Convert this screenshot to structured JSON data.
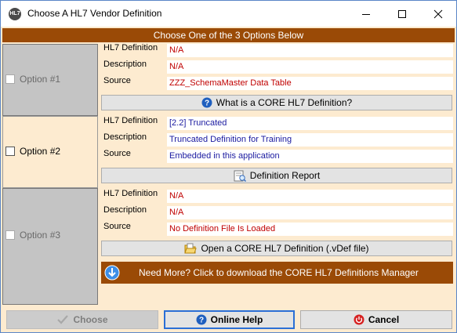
{
  "window": {
    "title": "Choose A HL7 Vendor Definition",
    "app_icon_text": "HL7"
  },
  "banner": {
    "text": "Choose One of the 3 Options Below"
  },
  "options": [
    {
      "label": "Option #1",
      "checked": false,
      "enabled": false,
      "fields": [
        {
          "label": "HL7 Definition",
          "value": "N/A",
          "color": "#c00000"
        },
        {
          "label": "Description",
          "value": "N/A",
          "color": "#c00000"
        },
        {
          "label": "Source",
          "value": "ZZZ_SchemaMaster Data Table",
          "color": "#c00000"
        }
      ],
      "button": {
        "label": "What is a CORE HL7 Definition?",
        "icon": "help-icon"
      }
    },
    {
      "label": "Option #2",
      "checked": false,
      "enabled": true,
      "fields": [
        {
          "label": "HL7 Definition",
          "value": "[2.2] Truncated",
          "color": "#1a1aa0"
        },
        {
          "label": "Description",
          "value": "Truncated Definition for Training",
          "color": "#1a1aa0"
        },
        {
          "label": "Source",
          "value": "Embedded in this application",
          "color": "#1a1aa0"
        }
      ],
      "button": {
        "label": "Definition Report",
        "icon": "report-icon"
      }
    },
    {
      "label": "Option #3",
      "checked": false,
      "enabled": false,
      "fields": [
        {
          "label": "HL7 Definition",
          "value": "N/A",
          "color": "#c00000"
        },
        {
          "label": "Description",
          "value": "N/A",
          "color": "#c00000"
        },
        {
          "label": "Source",
          "value": "No Definition File Is Loaded",
          "color": "#c00000"
        }
      ],
      "button": {
        "label": "Open a CORE HL7 Definition (.vDef file)",
        "icon": "open-folder-icon"
      }
    }
  ],
  "download": {
    "text": "Need More? Click to download the CORE HL7 Definitions Manager",
    "icon": "download-arrow-icon"
  },
  "footer": {
    "choose_label": "Choose",
    "help_label": "Online Help",
    "cancel_label": "Cancel"
  },
  "colors": {
    "accent_brown": "#9a4a06",
    "panel_bg": "#fdebd0",
    "value_red": "#c00000",
    "value_blue": "#1a1aa0",
    "focus_blue": "#2b6fd6"
  }
}
